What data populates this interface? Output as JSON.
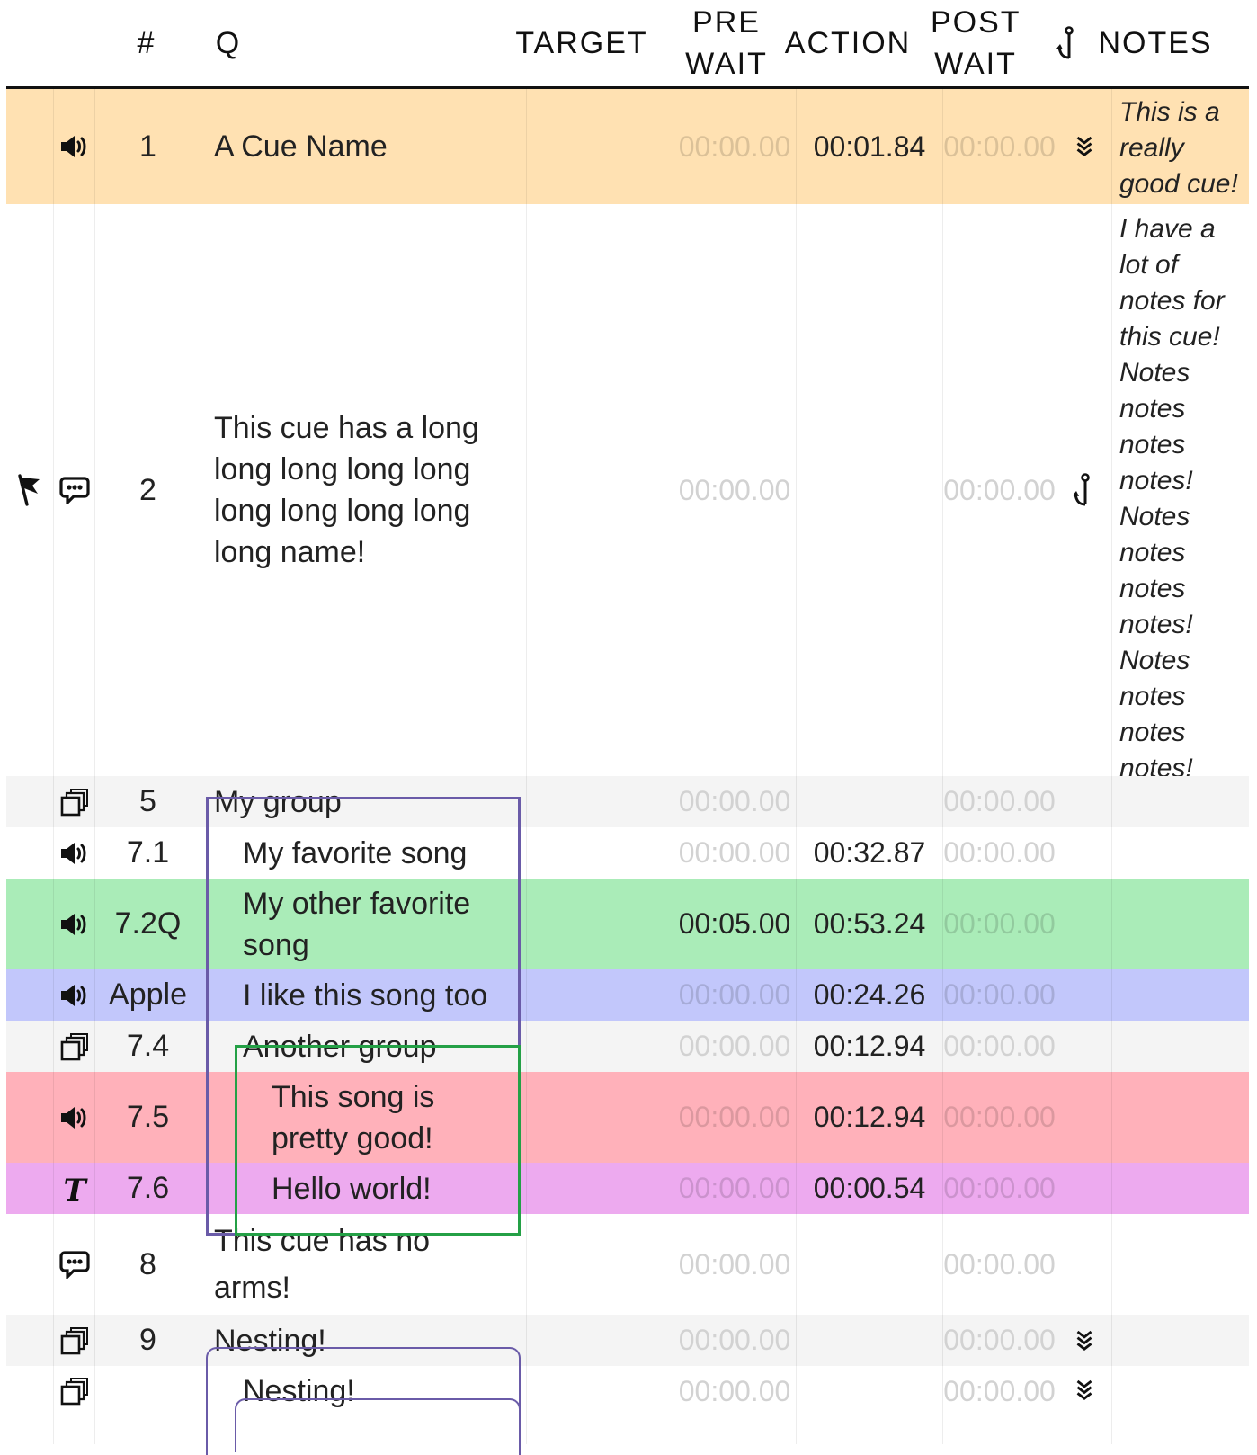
{
  "header": {
    "num": "#",
    "q": "Q",
    "target": "TARGET",
    "pre_wait": "PRE WAIT",
    "action": "ACTION",
    "post_wait": "POST WAIT",
    "continue_icon": "anchor-icon",
    "notes": "NOTES"
  },
  "colors": {
    "orange": "#ffe1b2",
    "green": "#aaecb8",
    "blue": "#c2c7fb",
    "grey": "#f4f4f4",
    "red": "#ffb1ba",
    "pink": "#edaaef",
    "group_outline_purple": "#6a5ba8",
    "group_outline_green": "#24a046"
  },
  "cues": [
    {
      "id": "cue-1",
      "flag": "",
      "type_icon": "speaker-icon",
      "num": "1",
      "name": "A Cue Name",
      "target": "",
      "pre_wait": "00:00.00",
      "action": "00:01.84",
      "post_wait": "00:00.00",
      "continue_icon": "auto-follow-icon",
      "notes": "This is a really good cue!"
    },
    {
      "id": "cue-2",
      "flag": "flag-icon",
      "type_icon": "speech-bubble-icon",
      "num": "2",
      "name": "This cue has a long long long long long long long long long long name!",
      "target": "",
      "pre_wait": "00:00.00",
      "action": "",
      "post_wait": "00:00.00",
      "continue_icon": "anchor-icon",
      "notes": "I have a lot of notes for this cue! Notes notes notes notes! Notes notes notes notes! Notes notes notes notes!"
    },
    {
      "id": "cue-5",
      "flag": "",
      "type_icon": "group-icon",
      "num": "5",
      "name": "My group",
      "target": "",
      "pre_wait": "00:00.00",
      "action": "",
      "post_wait": "00:00.00",
      "continue_icon": "",
      "notes": ""
    },
    {
      "id": "cue-7-1",
      "flag": "",
      "type_icon": "speaker-icon",
      "num": "7.1",
      "name": "My favorite song",
      "target": "",
      "pre_wait": "00:00.00",
      "action": "00:32.87",
      "post_wait": "00:00.00",
      "continue_icon": "",
      "notes": ""
    },
    {
      "id": "cue-7-2q",
      "flag": "",
      "type_icon": "speaker-icon",
      "num": "7.2Q",
      "name": "My other favorite song",
      "target": "",
      "pre_wait": "00:05.00",
      "action": "00:53.24",
      "post_wait": "00:00.00",
      "continue_icon": "",
      "notes": ""
    },
    {
      "id": "cue-apple",
      "flag": "",
      "type_icon": "speaker-icon",
      "num": "Apple",
      "name": "I like this song too",
      "target": "",
      "pre_wait": "00:00.00",
      "action": "00:24.26",
      "post_wait": "00:00.00",
      "continue_icon": "",
      "notes": ""
    },
    {
      "id": "cue-7-4",
      "flag": "",
      "type_icon": "group-icon",
      "num": "7.4",
      "name": "Another group",
      "target": "",
      "pre_wait": "00:00.00",
      "action": "00:12.94",
      "post_wait": "00:00.00",
      "continue_icon": "",
      "notes": ""
    },
    {
      "id": "cue-7-5",
      "flag": "",
      "type_icon": "speaker-icon",
      "num": "7.5",
      "name": "This song is pretty good!",
      "target": "",
      "pre_wait": "00:00.00",
      "action": "00:12.94",
      "post_wait": "00:00.00",
      "continue_icon": "",
      "notes": ""
    },
    {
      "id": "cue-7-6",
      "flag": "",
      "type_icon": "text-icon",
      "num": "7.6",
      "name": "Hello world!",
      "target": "",
      "pre_wait": "00:00.00",
      "action": "00:00.54",
      "post_wait": "00:00.00",
      "continue_icon": "",
      "notes": ""
    },
    {
      "id": "cue-8",
      "flag": "",
      "type_icon": "speech-bubble-icon",
      "num": "8",
      "name": "This cue has no arms!",
      "target": "",
      "pre_wait": "00:00.00",
      "action": "",
      "post_wait": "00:00.00",
      "continue_icon": "",
      "notes": ""
    },
    {
      "id": "cue-9",
      "flag": "",
      "type_icon": "group-icon",
      "num": "9",
      "name": "Nesting!",
      "target": "",
      "pre_wait": "00:00.00",
      "action": "",
      "post_wait": "00:00.00",
      "continue_icon": "auto-follow-icon",
      "notes": ""
    },
    {
      "id": "cue-9-child",
      "flag": "",
      "type_icon": "group-icon",
      "num": "",
      "name": "Nesting!",
      "target": "",
      "pre_wait": "00:00.00",
      "action": "",
      "post_wait": "00:00.00",
      "continue_icon": "auto-follow-icon",
      "notes": ""
    }
  ]
}
